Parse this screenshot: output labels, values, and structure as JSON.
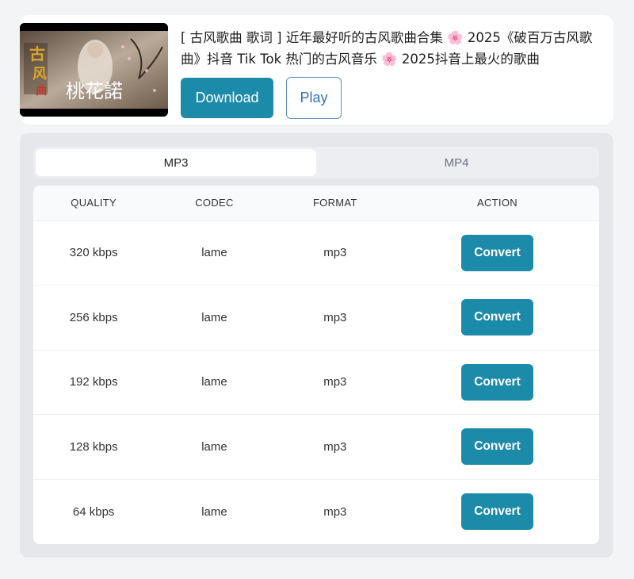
{
  "video": {
    "title": "[ 古风歌曲 歌词 ] 近年最好听的古风歌曲合集 🌸 2025《破百万古风歌曲》抖音 Tik Tok 热门的古风音乐 🌸 2025抖音上最火的歌曲",
    "thumbnail_text": "桃花諾",
    "download_label": "Download",
    "play_label": "Play"
  },
  "tabs": [
    {
      "label": "MP3",
      "active": true
    },
    {
      "label": "MP4",
      "active": false
    }
  ],
  "table": {
    "headers": [
      "QUALITY",
      "CODEC",
      "FORMAT",
      "ACTION"
    ],
    "rows": [
      {
        "quality": "320 kbps",
        "codec": "lame",
        "format": "mp3",
        "action": "Convert"
      },
      {
        "quality": "256 kbps",
        "codec": "lame",
        "format": "mp3",
        "action": "Convert"
      },
      {
        "quality": "192 kbps",
        "codec": "lame",
        "format": "mp3",
        "action": "Convert"
      },
      {
        "quality": "128 kbps",
        "codec": "lame",
        "format": "mp3",
        "action": "Convert"
      },
      {
        "quality": "64 kbps",
        "codec": "lame",
        "format": "mp3",
        "action": "Convert"
      }
    ]
  },
  "colors": {
    "accent": "#1b8ba9",
    "play_text": "#2f73b8"
  }
}
